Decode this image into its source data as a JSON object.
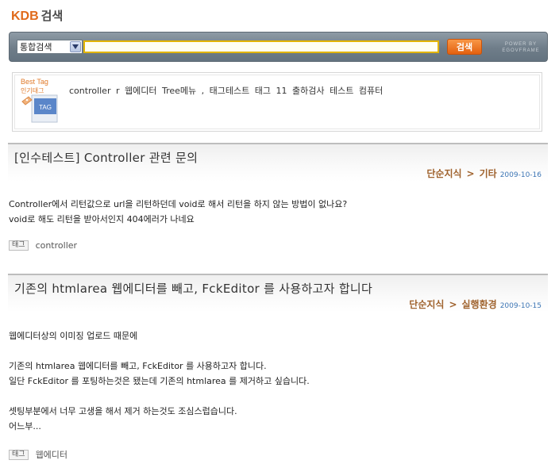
{
  "header": {
    "logo_brand": "KDB",
    "logo_text": "검색"
  },
  "search": {
    "scope_value": "통합검색",
    "query_value": "",
    "button_label": "검색",
    "powered_line1": "POWER BY",
    "powered_line2": "EGOVFRAME"
  },
  "best_tags": {
    "logo_en": "Best Tag",
    "logo_ko": "인기태그",
    "logo_badge": "TAG",
    "items": [
      "controller",
      "r",
      "웹에디터",
      "Tree메뉴",
      ",",
      "태그테스트",
      "태그",
      "11",
      "출하검사",
      "테스트",
      "컴퓨터"
    ]
  },
  "posts": [
    {
      "title": "[인수테스트] Controller 관련 문의",
      "category": "단순지식",
      "subcategory": "기타",
      "date": "2009-10-16",
      "body": [
        "Controller에서 리턴값으로 url을 리턴하던데 void로 해서 리턴을 하지 않는 방법이 없나요?",
        "void로 해도 리턴을 받아서인지 404에러가 나네요"
      ],
      "tag_label": "태그",
      "tag_value": "controller"
    },
    {
      "title": "기존의 htmlarea 웹에디터를 빼고, FckEditor 를 사용하고자 합니다",
      "category": "단순지식",
      "subcategory": "실행환경",
      "date": "2009-10-15",
      "body": [
        "웹에디터상의 이미징 업로드 때문에",
        "",
        "기존의 htmlarea 웹에디터를 빼고, FckEditor 를 사용하고자 합니다.",
        "일단 FckEditor 를 포팅하는것은 됐는데 기존의 htmlarea 를 제거하고 싶습니다.",
        "",
        "셋팅부분에서 너무 고생을 해서 제거 하는것도 조심스럽습니다.",
        "어느부..."
      ],
      "tag_label": "태그",
      "tag_value": "웹에디터"
    }
  ],
  "colors": {
    "accent_orange": "#e06a1a",
    "category_brown": "#a0632e",
    "date_blue": "#3d76b5",
    "searchbar_gray": "#6f7d89"
  }
}
